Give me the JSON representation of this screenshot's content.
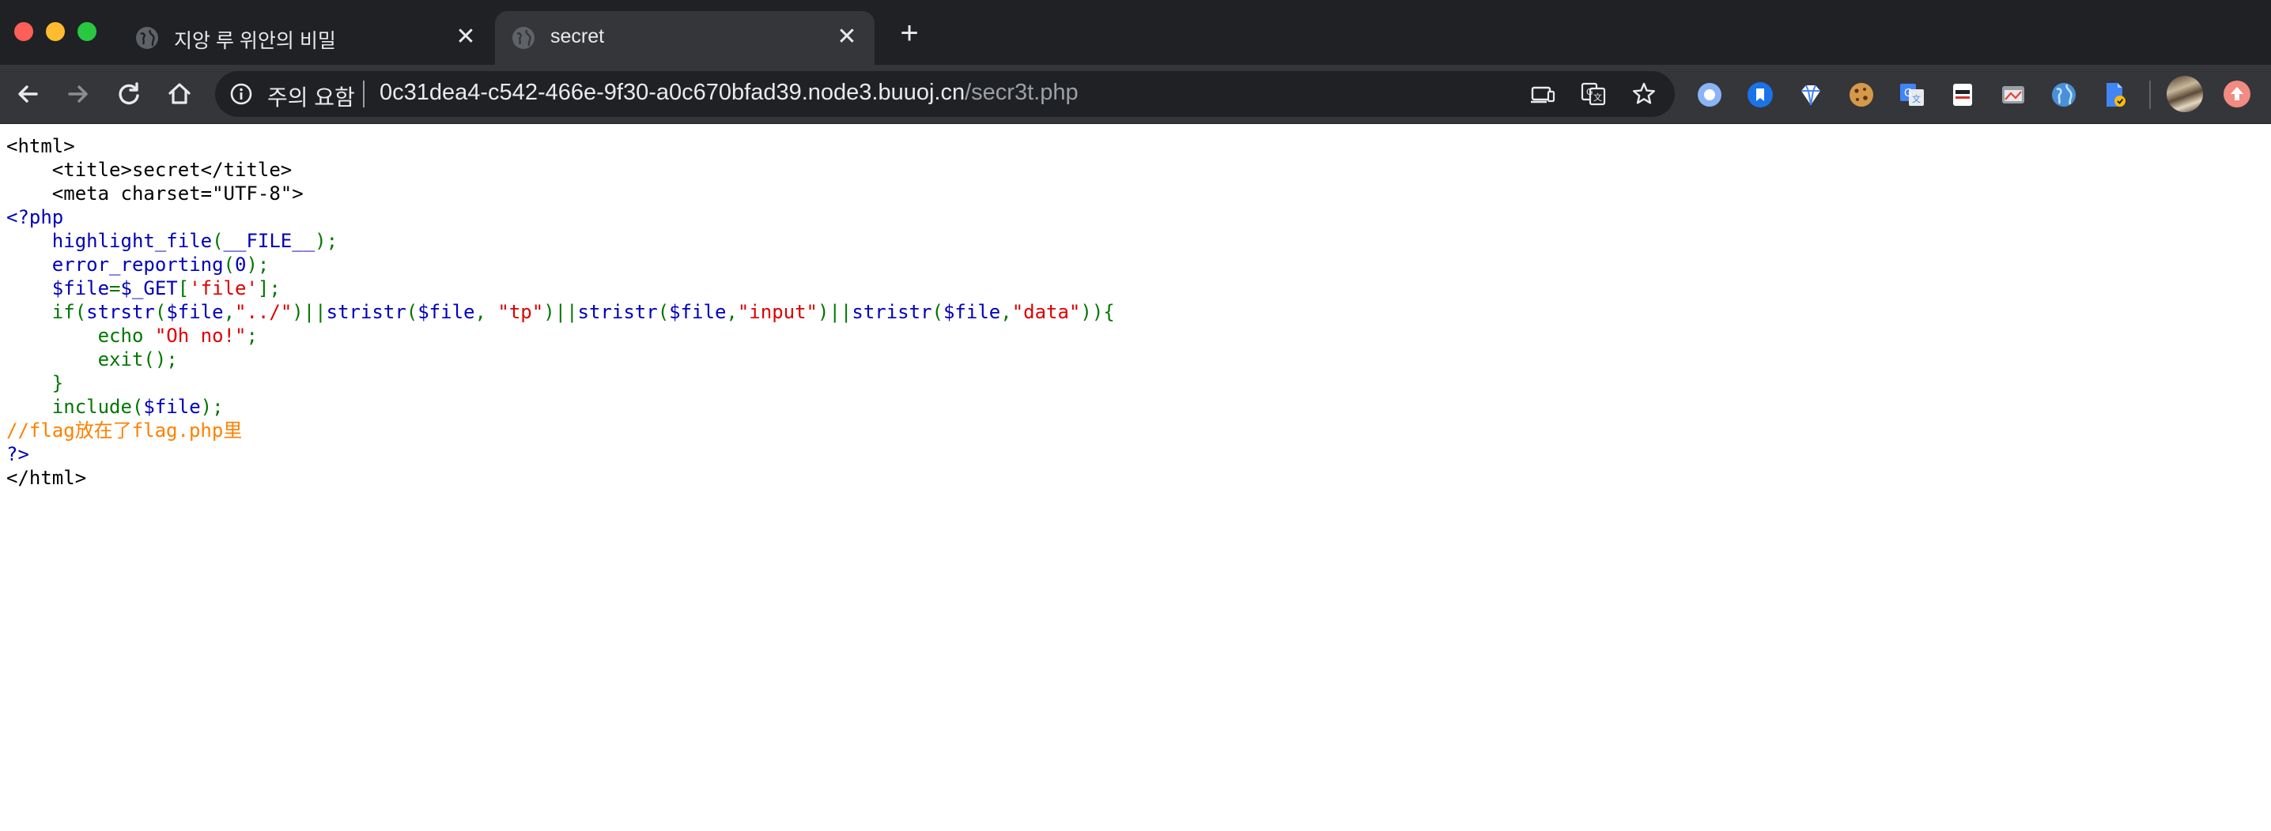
{
  "browser": {
    "tabs": [
      {
        "title": "지앙 루 위안의 비밀",
        "active": false,
        "close_glyph": "✕"
      },
      {
        "title": "secret",
        "active": true,
        "close_glyph": "✕"
      }
    ],
    "new_tab_glyph": "+",
    "omnibox": {
      "security_label": "주의 요함",
      "url_host": "0c31dea4-c542-466e-9f30-a0c670bfad39.node3.buuoj.cn",
      "url_path": "/secr3t.php"
    },
    "toolbar_icons": [
      "back-icon",
      "forward-icon",
      "reload-icon",
      "home-icon",
      "info-icon",
      "cast-icon",
      "translate-icon",
      "star-icon"
    ],
    "extensions": [
      "ring-extension-icon",
      "bookmark-extension-icon",
      "diamond-extension-icon",
      "cookie-extension-icon",
      "google-translate-extension-icon",
      "mask-extension-icon",
      "window-extension-icon",
      "globe-extension-icon",
      "file-extension-icon"
    ],
    "colors": {
      "tabstrip": "#202124",
      "toolbar": "#35363a",
      "omnibox": "#202124"
    }
  },
  "page": {
    "lines": [
      [
        {
          "t": "<html>",
          "c": "html"
        }
      ],
      [
        {
          "t": "    <title>secret</title>",
          "c": "html"
        }
      ],
      [
        {
          "t": "    <meta charset=\"UTF-8\">",
          "c": "html"
        }
      ],
      [
        {
          "t": "<?php",
          "c": "default"
        }
      ],
      [
        {
          "t": "    highlight_file",
          "c": "default"
        },
        {
          "t": "(",
          "c": "keyword"
        },
        {
          "t": "__FILE__",
          "c": "default"
        },
        {
          "t": ");",
          "c": "keyword"
        }
      ],
      [
        {
          "t": "    error_reporting",
          "c": "default"
        },
        {
          "t": "(",
          "c": "keyword"
        },
        {
          "t": "0",
          "c": "default"
        },
        {
          "t": ");",
          "c": "keyword"
        }
      ],
      [
        {
          "t": "    $file",
          "c": "default"
        },
        {
          "t": "=",
          "c": "keyword"
        },
        {
          "t": "$_GET",
          "c": "default"
        },
        {
          "t": "[",
          "c": "keyword"
        },
        {
          "t": "'file'",
          "c": "string"
        },
        {
          "t": "];",
          "c": "keyword"
        }
      ],
      [
        {
          "t": "    if(",
          "c": "keyword"
        },
        {
          "t": "strstr",
          "c": "default"
        },
        {
          "t": "(",
          "c": "keyword"
        },
        {
          "t": "$file",
          "c": "default"
        },
        {
          "t": ",",
          "c": "keyword"
        },
        {
          "t": "\"../\"",
          "c": "string"
        },
        {
          "t": ")||",
          "c": "keyword"
        },
        {
          "t": "stristr",
          "c": "default"
        },
        {
          "t": "(",
          "c": "keyword"
        },
        {
          "t": "$file",
          "c": "default"
        },
        {
          "t": ", ",
          "c": "keyword"
        },
        {
          "t": "\"tp\"",
          "c": "string"
        },
        {
          "t": ")||",
          "c": "keyword"
        },
        {
          "t": "stristr",
          "c": "default"
        },
        {
          "t": "(",
          "c": "keyword"
        },
        {
          "t": "$file",
          "c": "default"
        },
        {
          "t": ",",
          "c": "keyword"
        },
        {
          "t": "\"input\"",
          "c": "string"
        },
        {
          "t": ")||",
          "c": "keyword"
        },
        {
          "t": "stristr",
          "c": "default"
        },
        {
          "t": "(",
          "c": "keyword"
        },
        {
          "t": "$file",
          "c": "default"
        },
        {
          "t": ",",
          "c": "keyword"
        },
        {
          "t": "\"data\"",
          "c": "string"
        },
        {
          "t": ")){",
          "c": "keyword"
        }
      ],
      [
        {
          "t": "        echo ",
          "c": "keyword"
        },
        {
          "t": "\"Oh no!\"",
          "c": "string"
        },
        {
          "t": ";",
          "c": "keyword"
        }
      ],
      [
        {
          "t": "        exit();",
          "c": "keyword"
        }
      ],
      [
        {
          "t": "    }",
          "c": "keyword"
        }
      ],
      [
        {
          "t": "    include(",
          "c": "keyword"
        },
        {
          "t": "$file",
          "c": "default"
        },
        {
          "t": ");",
          "c": "keyword"
        }
      ],
      [
        {
          "t": "//flag放在了flag.php里",
          "c": "comment"
        }
      ],
      [
        {
          "t": "?>",
          "c": "default"
        }
      ],
      [
        {
          "t": "</html>",
          "c": "html"
        }
      ]
    ]
  }
}
